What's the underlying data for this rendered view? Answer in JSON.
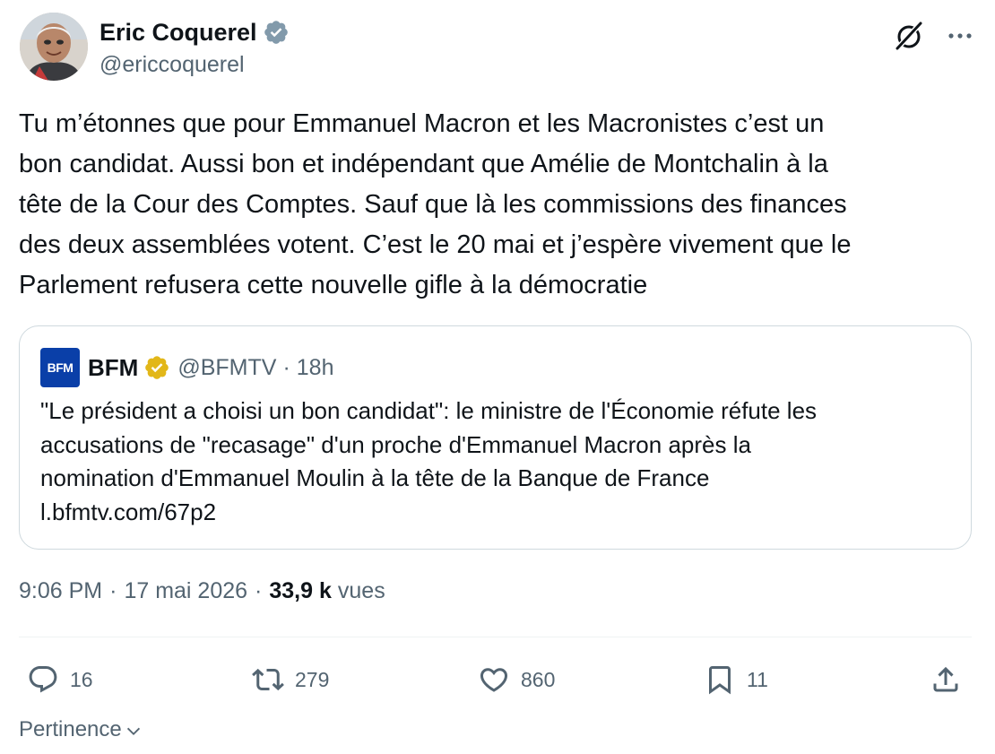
{
  "author": {
    "name": "Eric Coquerel",
    "handle": "@ericcoquerel"
  },
  "icons": {
    "verified": "verified-badge-icon",
    "grok": "grok-icon",
    "more": "more-icon",
    "reply": "reply-icon",
    "retweet": "retweet-icon",
    "like": "heart-icon",
    "bookmark": "bookmark-icon",
    "share": "share-icon",
    "chevron": "chevron-down-icon"
  },
  "colors": {
    "accent_blue": "#1d9bf0",
    "verified_blue": "#829aab",
    "gold": "#e2b719",
    "muted": "#536471",
    "text": "#0f1419",
    "border": "#cfd9de",
    "bfm_blue": "#0a3fa8"
  },
  "tweet": {
    "text": "Tu m’étonnes que pour Emmanuel Macron et les Macronistes c’est un\nbon candidat. Aussi bon et indépendant que Amélie de Montchalin à la\ntête de la Cour des Comptes. Sauf que là les commissions des finances\ndes deux assemblées votent. C’est le 20 mai et j’espère vivement que le\nParlement refusera cette nouvelle gifle à la démocratie"
  },
  "quote": {
    "logo_text": "BFM",
    "name": "BFM",
    "handle": "@BFMTV",
    "separator": "·",
    "time": "18h",
    "text": "\"Le président a choisi un bon candidat\": le ministre de l'Économie réfute les\naccusations de \"recasage\" d'un proche d'Emmanuel Macron après la\nnomination d'Emmanuel Moulin à la tête de la Banque de France\nl.bfmtv.com/67p2"
  },
  "meta": {
    "time": "9:06 PM",
    "dot1": "·",
    "date": "17 mai 2026",
    "dot2": "·",
    "views_count": "33,9 k",
    "views_label": "vues"
  },
  "actions": {
    "replies": "16",
    "retweets": "279",
    "likes": "860",
    "bookmarks": "11"
  },
  "sort": {
    "label": "Pertinence"
  }
}
